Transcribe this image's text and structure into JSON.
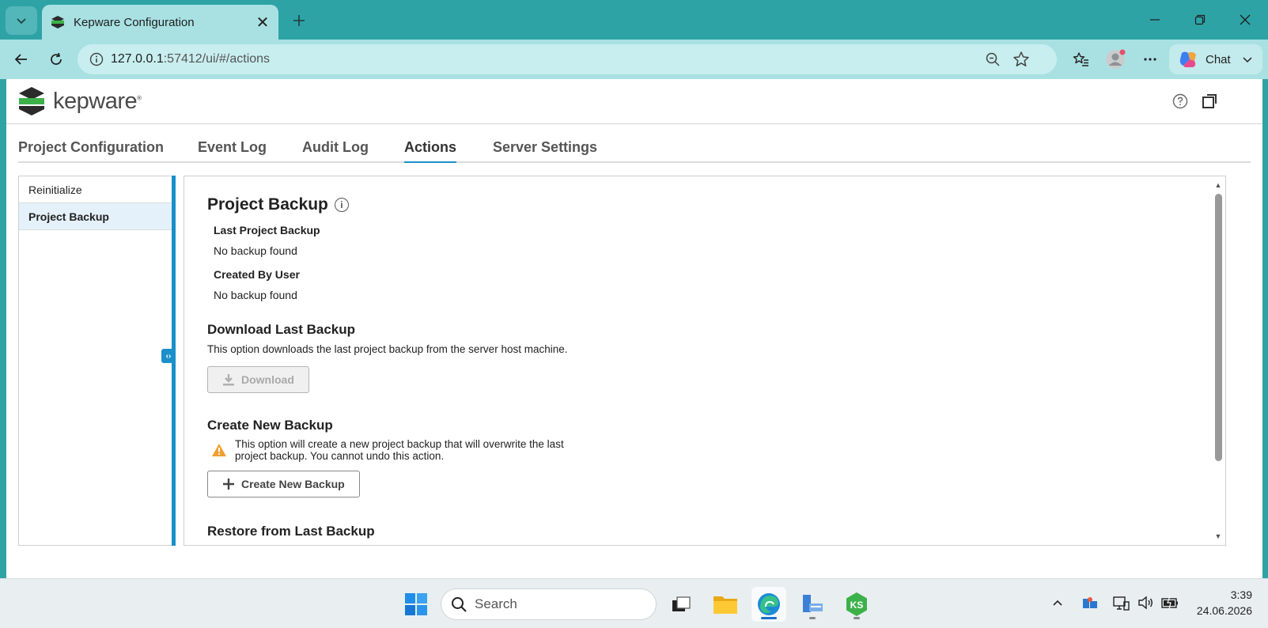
{
  "browser": {
    "tab_title": "Kepware Configuration",
    "url_host": "127.0.0.1",
    "url_rest": ":57412/ui/#/actions",
    "chat_label": "Chat",
    "accent_color": "#2ea3a6"
  },
  "app": {
    "logo_text": "kepware",
    "nav_tabs": [
      {
        "label": "Project Configuration"
      },
      {
        "label": "Event Log"
      },
      {
        "label": "Audit Log"
      },
      {
        "label": "Actions",
        "active": true
      },
      {
        "label": "Server Settings"
      }
    ],
    "sidebar": {
      "items": [
        {
          "label": "Reinitialize"
        },
        {
          "label": "Project Backup",
          "selected": true
        }
      ]
    },
    "content": {
      "title": "Project Backup",
      "last_backup_label": "Last Project Backup",
      "last_backup_value": "No backup found",
      "created_by_label": "Created By User",
      "created_by_value": "No backup found",
      "download_title": "Download Last Backup",
      "download_desc": "This option downloads the last project backup from the server host machine.",
      "download_button": "Download",
      "create_title": "Create New Backup",
      "create_warning_line1": "This option will create a new project backup that will overwrite the last",
      "create_warning_line2": "project backup. You cannot undo this action.",
      "create_button": "Create New Backup",
      "restore_title": "Restore from Last Backup"
    }
  },
  "taskbar": {
    "search_placeholder": "Search",
    "time": "3:39",
    "date": "24.06.2026"
  }
}
